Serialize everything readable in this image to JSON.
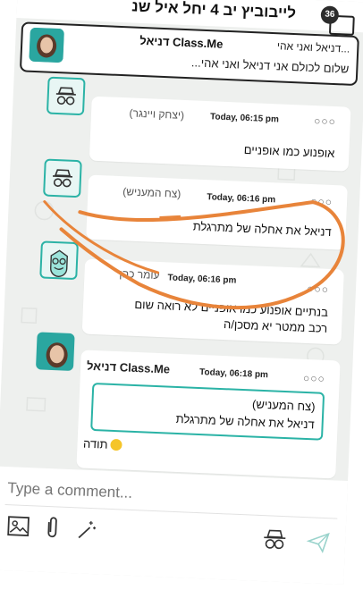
{
  "header": {
    "title": "לייבוביץ יב 4 יחל איל שנ",
    "notification_count": "36"
  },
  "pinned": {
    "author": "Class.Me דניאל",
    "preview": "...דניאל ואני אהי",
    "text": "שלום לכולם אני דניאל ואני אהי..."
  },
  "posts": [
    {
      "author": "(יצחק ויינגר)",
      "time": "Today, 06:15 pm",
      "body": "אופנוע כמו אופניים",
      "avatar": "glasses-hat-icon"
    },
    {
      "author": "(צח המעניש)",
      "time": "Today, 06:16 pm",
      "body": "דניאל את אחלה של מתרגלת",
      "avatar": "glasses-hat-icon"
    },
    {
      "author": "עומר כהן",
      "time": "Today, 06:16 pm",
      "body_line1": "בנתיים אופנוע כמו אופניים לא רואה שום",
      "body_line2": "רכב ממטר יא מסכן/ה",
      "avatar": "smiley-character-icon"
    },
    {
      "author": "Class.Me דניאל",
      "time": "Today, 06:18 pm",
      "quote_author": "(צח המעניש)",
      "quote_text": "דניאל את אחלה של מתרגלת",
      "body": "תודה",
      "avatar": "profile-photo"
    }
  ],
  "composer": {
    "placeholder": "Type a comment..."
  },
  "colors": {
    "accent": "#2bb3a6",
    "annotation": "#e8843a",
    "background": "#eef0ee"
  }
}
